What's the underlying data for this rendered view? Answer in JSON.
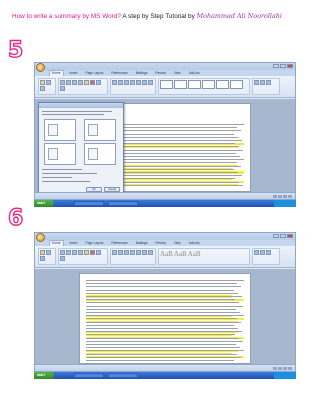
{
  "header": {
    "part1": "How to write a summary by MS Word?",
    "part2": " A step by Step Tutorial by ",
    "part3": "Mohammad Ali Noorollahi"
  },
  "steps": [
    {
      "number": "5"
    },
    {
      "number": "6"
    }
  ],
  "word": {
    "tabs": [
      "Home",
      "Insert",
      "Page Layout",
      "References",
      "Mailings",
      "Review",
      "View",
      "Add-Ins"
    ],
    "start_label": "start"
  },
  "dialog": {
    "ok_label": "OK",
    "cancel_label": "Cancel"
  }
}
